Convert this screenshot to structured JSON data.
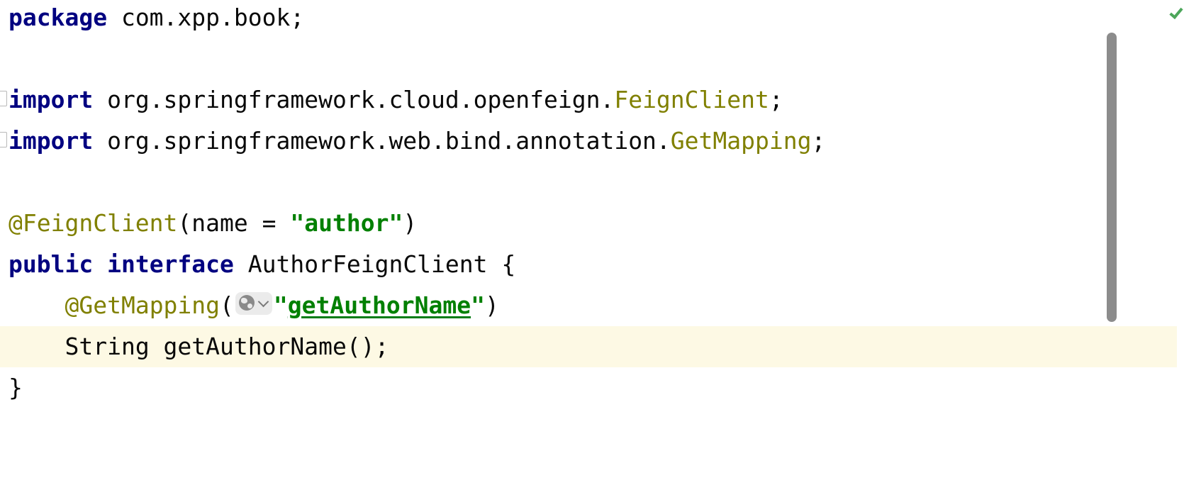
{
  "editor": {
    "status": {
      "icon": "checkmark-icon",
      "color": "#4ca65a"
    },
    "lines": {
      "l1": {
        "kw": "package",
        "rest": " com.xpp.book;"
      },
      "l3": {
        "kw": "import",
        "pkg": " org.springframework.cloud.openfeign.",
        "cls": "FeignClient",
        "end": ";"
      },
      "l4": {
        "kw": "import",
        "pkg": " org.springframework.web.bind.annotation.",
        "cls": "GetMapping",
        "end": ";"
      },
      "l6": {
        "ann": "@FeignClient",
        "open": "(name = ",
        "str": "\"author\"",
        "close": ")"
      },
      "l7": {
        "kw1": "public",
        "kw2": "interface",
        "rest": " AuthorFeignClient {"
      },
      "l8": {
        "ann": "@GetMapping",
        "open": "(",
        "q1": "\"",
        "str": "getAuthorName",
        "q2": "\"",
        "close": ")"
      },
      "l9": {
        "text": "String getAuthorName();"
      },
      "l10": {
        "text": "}"
      }
    },
    "colors": {
      "keyword": "#000080",
      "annotation": "#808000",
      "string": "#008000",
      "current_line": "#fdf9e4"
    }
  }
}
